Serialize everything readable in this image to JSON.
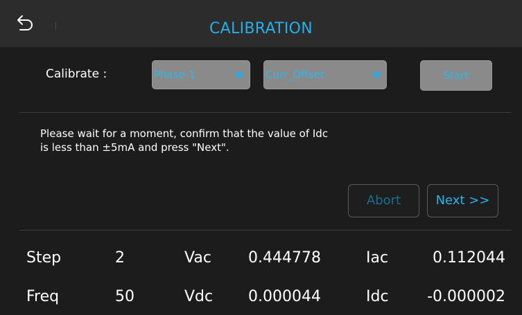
{
  "header": {
    "title": "CALIBRATION",
    "back_icon": "return-arrow-icon"
  },
  "calibrate": {
    "label": "Calibrate :",
    "phase_select": {
      "value": "Phase-1"
    },
    "mode_select": {
      "value": "Curr_Offset"
    },
    "start_label": "Start"
  },
  "message": "Please wait for a moment, confirm that the value of Idc is less than ±5mA and press \"Next\".",
  "actions": {
    "abort_label": "Abort",
    "next_label": "Next >>"
  },
  "readings": {
    "row1": {
      "label1": "Step",
      "value1": "2",
      "label2": "Vac",
      "value2": "0.444778",
      "label3": "Iac",
      "value3": "0.112044"
    },
    "row2": {
      "label1": "Freq",
      "value1": "50",
      "label2": "Vdc",
      "value2": "0.000044",
      "label3": "Idc",
      "value3": "-0.000002"
    }
  },
  "colors": {
    "accent": "#26b0e8",
    "titlebar_bg": "#2c2c2c",
    "background": "#1c1c1c",
    "disabled_control_bg": "#8a8a8a"
  }
}
